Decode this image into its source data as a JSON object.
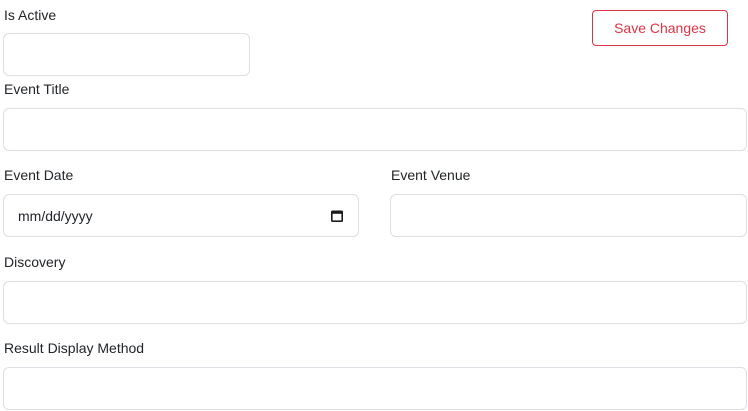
{
  "toolbar": {
    "save_label": "Save Changes"
  },
  "fields": {
    "is_active": {
      "label": "Is Active",
      "value": ""
    },
    "event_title": {
      "label": "Event Title",
      "value": ""
    },
    "event_date": {
      "label": "Event Date",
      "placeholder": "mm/dd/yyyy"
    },
    "event_venue": {
      "label": "Event Venue",
      "value": ""
    },
    "discovery": {
      "label": "Discovery",
      "value": ""
    },
    "result_display_method": {
      "label": "Result Display Method",
      "value": ""
    }
  },
  "colors": {
    "accent": "#dc3545",
    "border": "#dcdfe3",
    "text": "#212529"
  },
  "icons": {
    "date_picker": "calendar-icon"
  }
}
